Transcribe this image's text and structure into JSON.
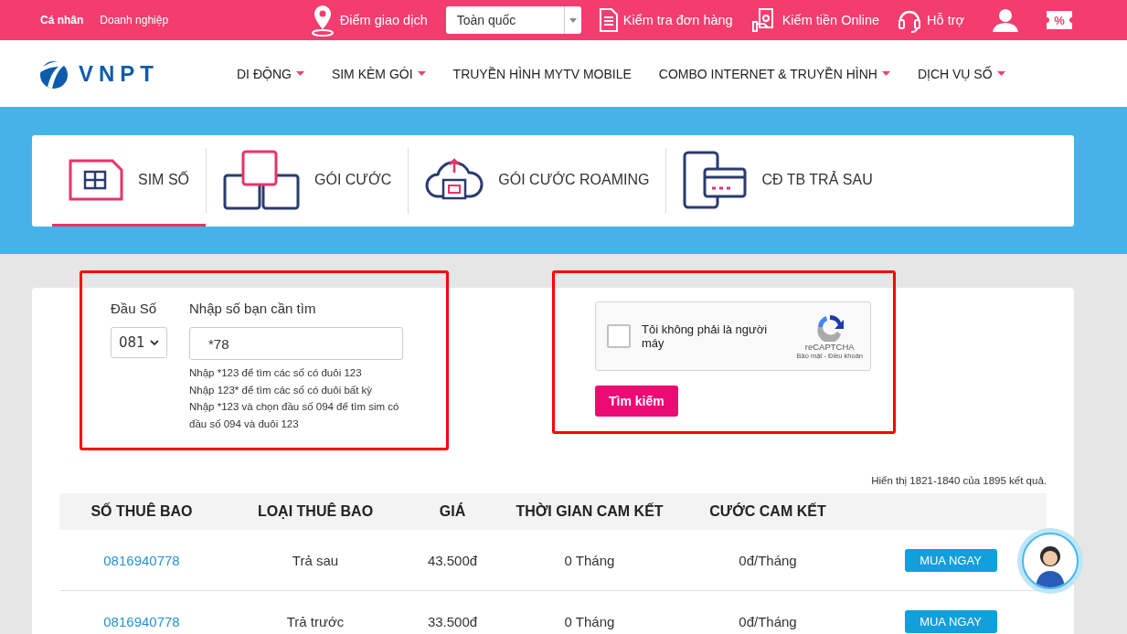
{
  "topbar": {
    "segments": [
      {
        "label": "Cá nhân",
        "selected": true
      },
      {
        "label": "Doanh nghiệp",
        "selected": false
      }
    ],
    "location_link": "Điểm giao dịch",
    "region_select": {
      "value": "Toàn quốc"
    },
    "links": [
      {
        "kind": "order",
        "label": "Kiểm tra đơn hàng"
      },
      {
        "kind": "money",
        "label": "Kiếm tiền Online"
      },
      {
        "kind": "support",
        "label": "Hỗ trợ"
      }
    ],
    "discount_badge": "%"
  },
  "nav": {
    "logo": "VNPT",
    "items": [
      {
        "label": "DI ĐỘNG",
        "dropdown": true
      },
      {
        "label": "SIM KÈM GÓI",
        "dropdown": true
      },
      {
        "label": "TRUYỀN HÌNH MYTV MOBILE",
        "dropdown": false
      },
      {
        "label": "COMBO INTERNET & TRUYỀN HÌNH",
        "dropdown": true
      },
      {
        "label": "DỊCH VỤ SỐ",
        "dropdown": true
      }
    ]
  },
  "service_tabs": [
    {
      "kind": "sim",
      "label": "SIM SỐ",
      "selected": true
    },
    {
      "kind": "package",
      "label": "GÓI CƯỚC",
      "selected": false
    },
    {
      "kind": "roaming",
      "label": "GÓI CƯỚC ROAMING",
      "selected": false
    },
    {
      "kind": "postpaid",
      "label": "CĐ TB TRẢ SAU",
      "selected": false
    }
  ],
  "search": {
    "prefix_label": "Đầu Số",
    "prefix_value": "081",
    "number_label": "Nhập số bạn cần tìm",
    "number_value": "*78",
    "hints": [
      "Nhập *123 để tìm các số có đuôi 123",
      "Nhập 123* để tìm các số có đuôi bất kỳ",
      "Nhập *123 và chọn đầu số 094 để tìm sim có đầu số 094 và đuôi 123"
    ],
    "captcha": {
      "label": "Tôi không phải là người máy",
      "checked": false,
      "brand": "reCAPTCHA",
      "terms": "Bảo mật - Điều khoản"
    },
    "button": "Tìm kiếm"
  },
  "results": {
    "summary": "Hiển thị 1821-1840 của 1895 kết quả.",
    "columns": [
      "SỐ THUÊ BAO",
      "LOẠI THUÊ BAO",
      "GIÁ",
      "THỜI GIAN CAM KẾT",
      "CƯỚC CAM KẾT"
    ],
    "rows": [
      {
        "number": "0816940778",
        "type": "Trả sau",
        "price": "43.500đ",
        "term": "0 Tháng",
        "fee": "0đ/Tháng",
        "button": "MUA NGAY"
      },
      {
        "number": "0816940778",
        "type": "Trả trước",
        "price": "33.500đ",
        "term": "0 Tháng",
        "fee": "0đ/Tháng",
        "button": "MUA NGAY"
      }
    ]
  }
}
